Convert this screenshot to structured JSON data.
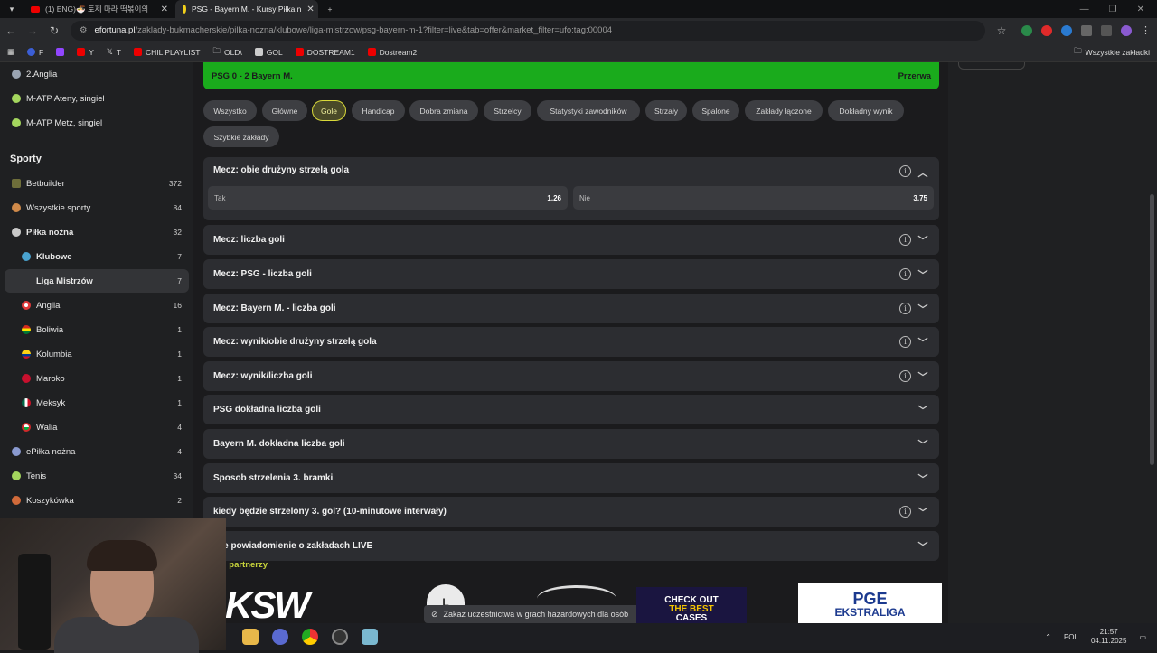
{
  "browser": {
    "tabs": [
      {
        "label": "(1) ENG)🍜 토제 마라 떡볶이의",
        "active": false
      },
      {
        "label": "PSG - Bayern M. - Kursy Piłka n",
        "active": true
      }
    ],
    "url_host": "efortuna.pl",
    "url_path": "/zaklady-bukmacherskie/pilka-nozna/klubowe/liga-mistrzow/psg-bayern-m-1?filter=live&tab=offer&market_filter=ufo:tag:00004",
    "extension_badge": "19",
    "bookmarks": [
      "F",
      "",
      "Y",
      "T",
      "CHIL PLAYLIST",
      "OLD\\",
      "GOL",
      "DOSTREAM1",
      "Dostream2"
    ],
    "bookmarks_all": "Wszystkie zakładki"
  },
  "sidebar": {
    "top_items": [
      {
        "label": "2.Anglia",
        "count": "",
        "color": "#9aa4b2"
      },
      {
        "label": "M-ATP Ateny, singiel",
        "count": "",
        "color": "#a4d65e"
      },
      {
        "label": "M-ATP Metz, singiel",
        "count": "",
        "color": "#a4d65e"
      }
    ],
    "section_title": "Sporty",
    "items": [
      {
        "label": "Betbuilder",
        "count": "372",
        "color": "#6e6e3a"
      },
      {
        "label": "Wszystkie sporty",
        "count": "84",
        "color": "#d08a4a"
      },
      {
        "label": "Piłka nożna",
        "count": "32",
        "color": "#c9c9c9"
      },
      {
        "label": "Klubowe",
        "count": "7",
        "color": "#4aa3d0"
      },
      {
        "label": "Liga Mistrzów",
        "count": "7",
        "color": ""
      },
      {
        "label": "Anglia",
        "count": "16",
        "color": "#e03a3a"
      },
      {
        "label": "Boliwia",
        "count": "1",
        "color": "#e8c020"
      },
      {
        "label": "Kolumbia",
        "count": "1",
        "color": "#f2d01a"
      },
      {
        "label": "Maroko",
        "count": "1",
        "color": "#c8102e"
      },
      {
        "label": "Meksyk",
        "count": "1",
        "color": "#3aa04a"
      },
      {
        "label": "Walia",
        "count": "4",
        "color": "#d02a2a"
      },
      {
        "label": "ePiłka nożna",
        "count": "4",
        "color": "#8a9ad0"
      },
      {
        "label": "Tenis",
        "count": "34",
        "color": "#a4d65e"
      },
      {
        "label": "Koszykówka",
        "count": "2",
        "color": "#d06a3a"
      }
    ]
  },
  "match": {
    "teams": "PSG  0 - 2  Bayern M.",
    "status": "Przerwa"
  },
  "filters": {
    "chips": [
      "Wszystko",
      "Główne",
      "Gole",
      "Handicap",
      "Dobra zmiana",
      "Strzelcy",
      "Statystyki zawodników",
      "Strzały",
      "Spalone",
      "Zakłady łączone",
      "Dokładny wynik",
      "Szybkie zakłady"
    ],
    "active": "Gole"
  },
  "markets": [
    {
      "title": "Mecz: obie drużyny strzelą gola",
      "info": true,
      "open": true,
      "odds": [
        {
          "label": "Tak",
          "value": "1.26"
        },
        {
          "label": "Nie",
          "value": "3.75"
        }
      ]
    },
    {
      "title": "Mecz: liczba goli",
      "info": true,
      "open": false
    },
    {
      "title": "Mecz: PSG - liczba goli",
      "info": true,
      "open": false
    },
    {
      "title": "Mecz: Bayern M. - liczba goli",
      "info": true,
      "open": false
    },
    {
      "title": "Mecz: wynik/obie drużyny strzelą gola",
      "info": true,
      "open": false
    },
    {
      "title": "Mecz: wynik/liczba goli",
      "info": true,
      "open": false
    },
    {
      "title": "PSG dokładna liczba goli",
      "info": false,
      "open": false
    },
    {
      "title": "Bayern M. dokładna liczba goli",
      "info": false,
      "open": false
    },
    {
      "title": "Sposob strzelenia 3. bramki",
      "info": false,
      "open": false
    },
    {
      "title": "kiedy będzie strzelony 3. gol? (10-minutowe interwały)",
      "info": true,
      "open": false
    },
    {
      "title": "żne powiadomienie o zakładach LIVE",
      "info": false,
      "open": false
    }
  ],
  "partners": {
    "title": "i partnerzy",
    "ksw": "KSW",
    "legia": "L",
    "pge_top": "PGE",
    "pge_bottom": "EKSTRALIGA"
  },
  "toast": "Zakaz uczestnictwa w grach hazardowych dla osób",
  "promo": {
    "line1": "CHECK OUT",
    "line2": "THE BEST",
    "line3": "CASES"
  },
  "taskbar": {
    "lang": "POL",
    "time": "21:57",
    "date": "04.11.2025"
  },
  "colors": {
    "accent_green": "#1aab1c",
    "active_chip": "#d9d93a"
  }
}
